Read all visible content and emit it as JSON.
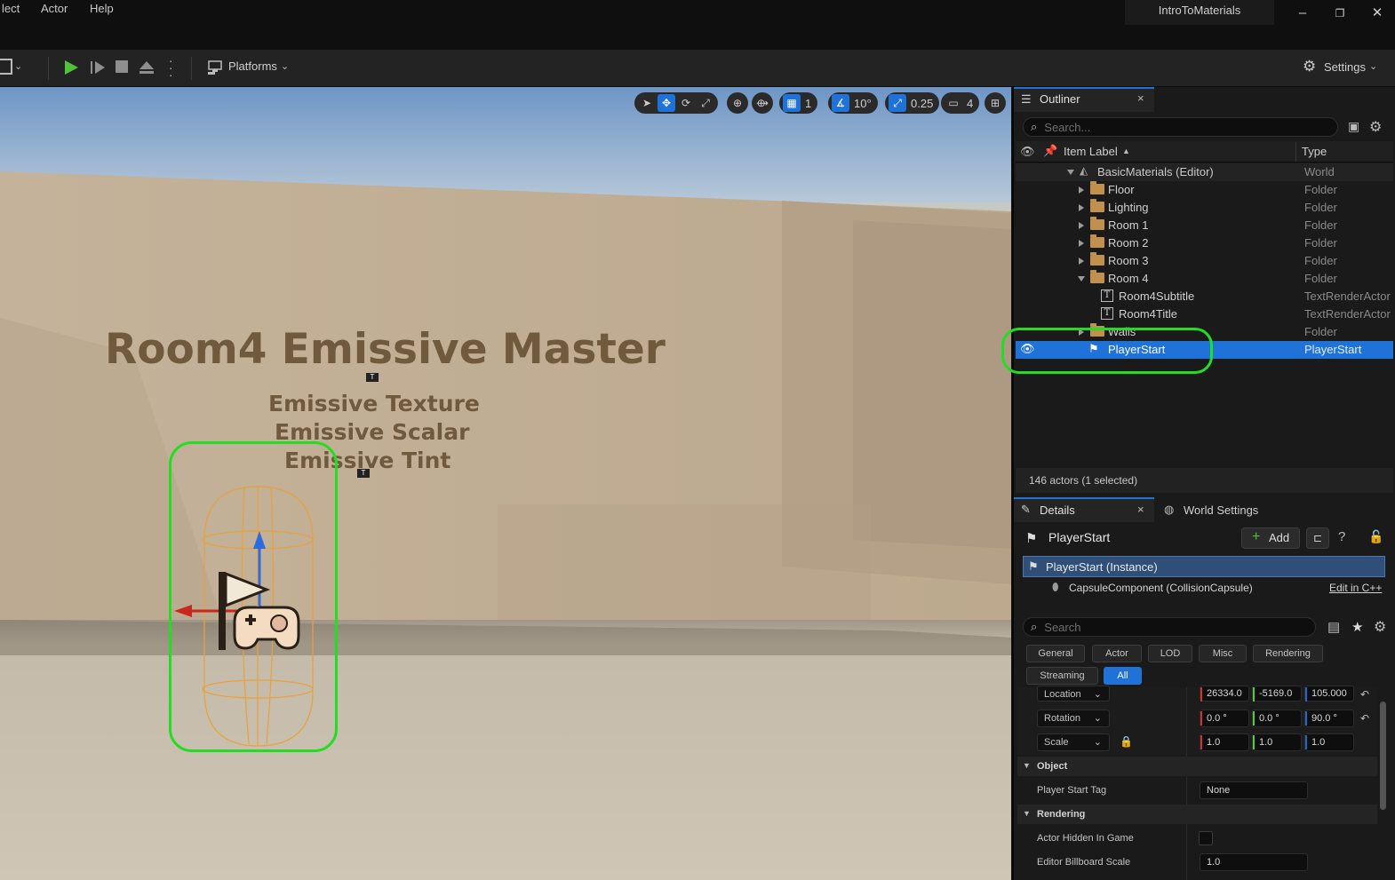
{
  "menu": {
    "items": [
      "lect",
      "Actor",
      "Help"
    ]
  },
  "window": {
    "project_name": "IntroToMaterials"
  },
  "toolbar": {
    "platforms_label": "Platforms",
    "settings_label": "Settings"
  },
  "viewport": {
    "snap_grid_value": "1",
    "snap_rotation_value": "10°",
    "snap_scale_value": "0.25",
    "camera_speed_value": "4",
    "wall_title": "Room4 Emissive Master",
    "wall_subtitle_lines": [
      "Emissive Texture",
      "Emissive Scalar",
      "Emissive Tint"
    ]
  },
  "outliner": {
    "tab_label": "Outliner",
    "search_placeholder": "Search...",
    "col_label": "Item Label",
    "col_type": "Type",
    "rows": [
      {
        "label": "BasicMaterials (Editor)",
        "type": "World"
      },
      {
        "label": "Floor",
        "type": "Folder"
      },
      {
        "label": "Lighting",
        "type": "Folder"
      },
      {
        "label": "Room 1",
        "type": "Folder"
      },
      {
        "label": "Room 2",
        "type": "Folder"
      },
      {
        "label": "Room 3",
        "type": "Folder"
      },
      {
        "label": "Room 4",
        "type": "Folder"
      },
      {
        "label": "Room4Subtitle",
        "type": "TextRenderActor"
      },
      {
        "label": "Room4Title",
        "type": "TextRenderActor"
      },
      {
        "label": "Walls",
        "type": "Folder"
      },
      {
        "label": "PlayerStart",
        "type": "PlayerStart"
      }
    ],
    "status": "146 actors (1 selected)"
  },
  "details": {
    "tab_label": "Details",
    "world_settings_label": "World Settings",
    "actor_name": "PlayerStart",
    "add_label": "Add",
    "instance_label": "PlayerStart (Instance)",
    "component_label": "CapsuleComponent (CollisionCapsule)",
    "edit_cpp_label": "Edit in C++",
    "search_placeholder": "Search",
    "filters": [
      "General",
      "Actor",
      "LOD",
      "Misc",
      "Rendering",
      "Streaming",
      "All"
    ],
    "transform": {
      "location_label": "Location",
      "location": [
        "26334.0",
        "-5169.0",
        "105.000"
      ],
      "rotation_label": "Rotation",
      "rotation": [
        "0.0 °",
        "0.0 °",
        "90.0 °"
      ],
      "scale_label": "Scale",
      "scale": [
        "1.0",
        "1.0",
        "1.0"
      ]
    },
    "object_category": "Object",
    "player_start_tag_label": "Player Start Tag",
    "player_start_tag_value": "None",
    "rendering_category": "Rendering",
    "actor_hidden_label": "Actor Hidden In Game",
    "billboard_scale_label": "Editor Billboard Scale",
    "billboard_scale_value": "1.0"
  },
  "colors": {
    "highlight": "#22dd22",
    "selection": "#1e72d8",
    "play": "#4fc13a"
  }
}
